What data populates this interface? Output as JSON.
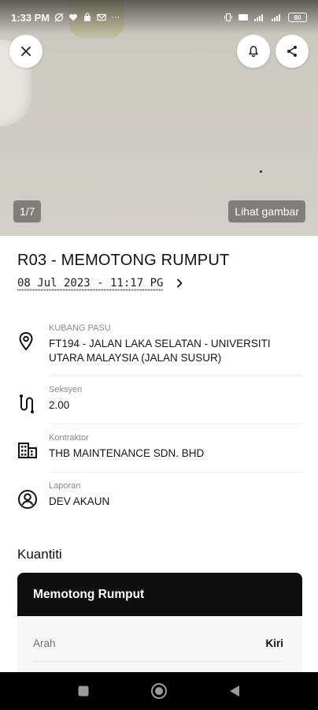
{
  "status_bar": {
    "time": "1:33 PM",
    "battery": "80"
  },
  "photo": {
    "counter": "1/7",
    "view_image_label": "Lihat gambar"
  },
  "report": {
    "title": "R03 - MEMOTONG RUMPUT",
    "datetime": "08 Jul 2023 - 11:17 PG"
  },
  "details": [
    {
      "label": "KUBANG PASU",
      "value": "FT194 - JALAN LAKA SELATAN - UNIVERSITI UTARA MALAYSIA (JALAN SUSUR)",
      "icon": "location-pin-icon"
    },
    {
      "label": "Seksyen",
      "value": "2.00",
      "icon": "route-icon"
    },
    {
      "label": "Kontraktor",
      "value": "THB MAINTENANCE SDN. BHD",
      "icon": "building-icon"
    },
    {
      "label": "Laporan",
      "value": "DEV AKAUN",
      "icon": "user-circle-icon"
    }
  ],
  "quantity": {
    "section_title": "Kuantiti",
    "card_title": "Memotong Rumput",
    "rows": [
      {
        "key": "Arah",
        "value": "Kiri"
      }
    ]
  },
  "colors": {
    "card_header": "#0f0f0f",
    "nav_bar": "#000000"
  }
}
